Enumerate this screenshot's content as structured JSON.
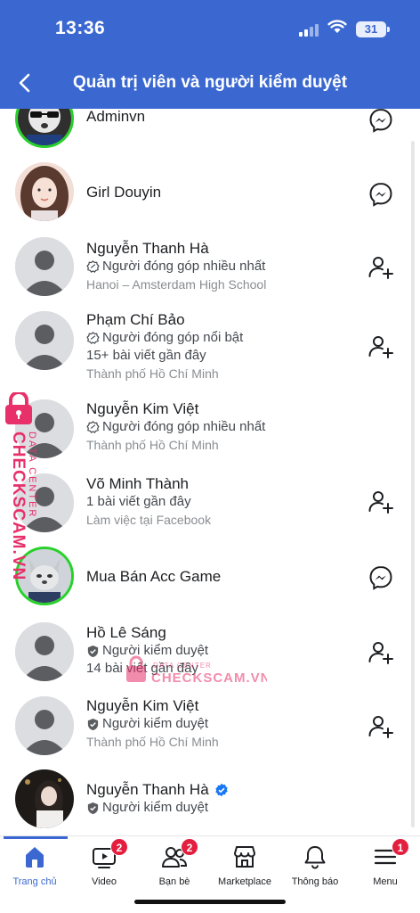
{
  "status_bar": {
    "time": "13:36",
    "battery": "31"
  },
  "header": {
    "title": "Quản trị viên và người kiểm duyệt"
  },
  "members": [
    {
      "name": "Adminvn",
      "action": "messenger-icon"
    },
    {
      "name": "Girl Douyin",
      "action": "messenger-icon"
    },
    {
      "name": "Nguyễn Thanh Hà",
      "badge": "Người đóng góp nhiều nhất",
      "detail": "Hanoi – Amsterdam High School",
      "action": "add-friend-icon"
    },
    {
      "name": "Phạm Chí Bảo",
      "badge": "Người đóng góp nổi bật",
      "posts": "15+ bài viết gần đây",
      "detail": "Thành phố Hồ Chí Minh",
      "action": "add-friend-icon"
    },
    {
      "name": "Nguyễn Kim Việt",
      "badge": "Người đóng góp nhiều nhất",
      "detail": "Thành phố Hồ Chí Minh"
    },
    {
      "name": "Võ Minh Thành",
      "posts": "1 bài viết gần đây",
      "detail": "Làm việc tại Facebook",
      "action": "add-friend-icon"
    },
    {
      "name": "Mua Bán Acc Game",
      "action": "messenger-icon"
    },
    {
      "name": "Hồ Lê Sáng",
      "badge": "Người kiểm duyệt",
      "posts": "14 bài viết gần đây",
      "action": "add-friend-icon"
    },
    {
      "name": "Nguyễn Kim Việt",
      "badge": "Người kiểm duyệt",
      "detail": "Thành phố Hồ Chí Minh",
      "action": "add-friend-icon"
    },
    {
      "name": "Nguyễn Thanh Hà",
      "badge": "Người kiểm duyệt",
      "verified": true
    }
  ],
  "watermark": {
    "brand": "CHECKSCAM.VN",
    "tagline": "DATA CENTER"
  },
  "tabs": [
    {
      "label": "Trang chủ",
      "icon": "home-icon",
      "active": true
    },
    {
      "label": "Video",
      "icon": "video-icon",
      "count": "2"
    },
    {
      "label": "Bạn bè",
      "icon": "friends-icon",
      "count": "2"
    },
    {
      "label": "Marketplace",
      "icon": "marketplace-icon"
    },
    {
      "label": "Thông báo",
      "icon": "bell-icon"
    },
    {
      "label": "Menu",
      "icon": "menu-icon",
      "count": "1"
    }
  ],
  "colors": {
    "brand_blue": "#3b68d0",
    "badge_red": "#e41e3f",
    "online_green": "#27d12a",
    "watermark_pink": "#e8306a"
  }
}
